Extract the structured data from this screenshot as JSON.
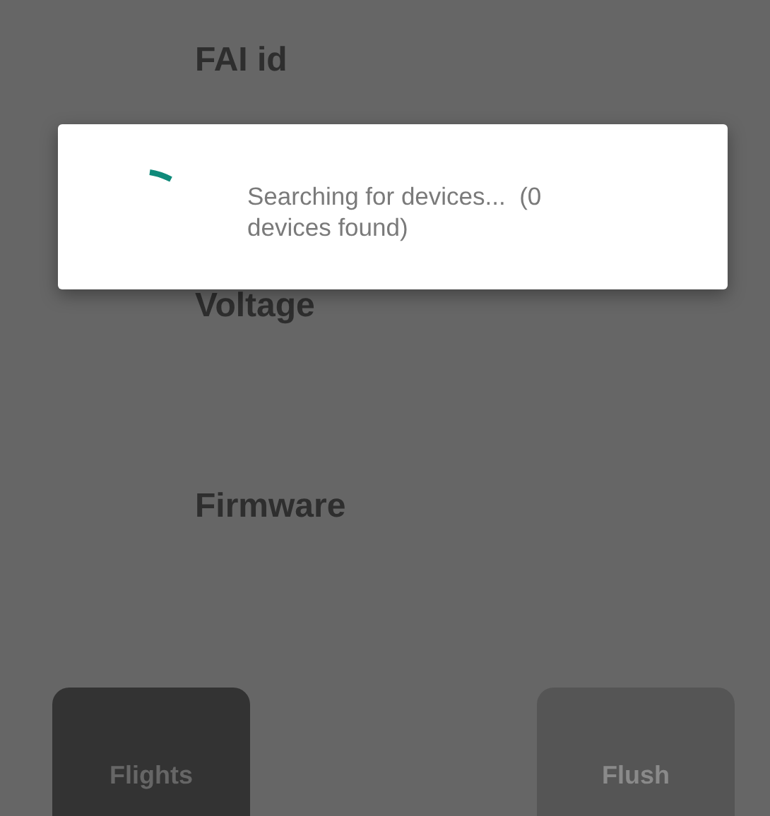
{
  "fields": [
    {
      "label": "FAI id"
    },
    {
      "label": "Voltage"
    },
    {
      "label": "Firmware"
    }
  ],
  "dialog": {
    "message": "Searching for devices...  (0 devices found)"
  },
  "buttons": [
    {
      "label": "Flights",
      "disabled": false
    },
    {
      "label": "Flush",
      "disabled": true
    }
  ]
}
